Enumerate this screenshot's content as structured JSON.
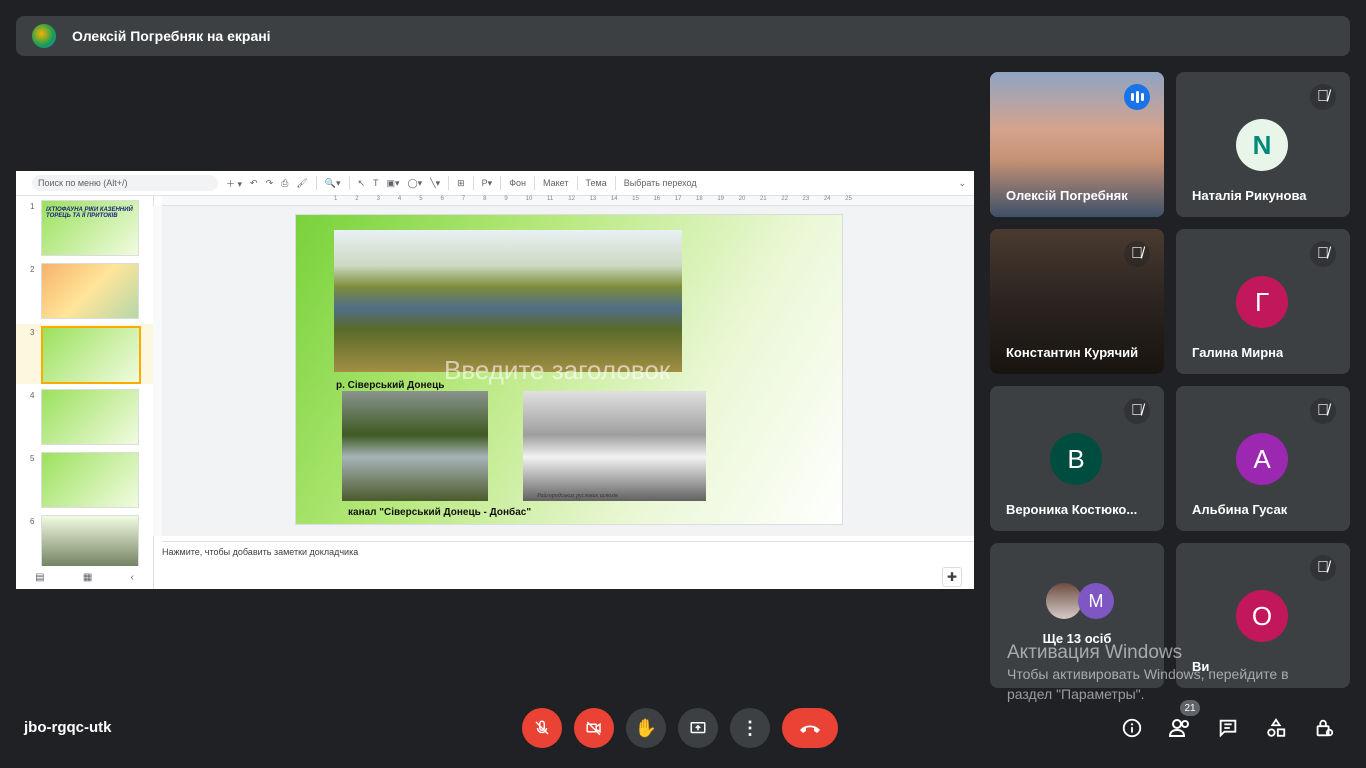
{
  "header": {
    "presenter_title": "Олексій Погребняк на екрані"
  },
  "toolbar": {
    "search_placeholder": "Поиск по меню (Alt+/)",
    "background": "Фон",
    "layout": "Макет",
    "theme": "Тема",
    "transition": "Выбрать переход"
  },
  "ruler": {
    "ticks": [
      "1",
      "2",
      "3",
      "4",
      "5",
      "6",
      "7",
      "8",
      "9",
      "10",
      "11",
      "12",
      "13",
      "14",
      "15",
      "16",
      "17",
      "18",
      "19",
      "20",
      "21",
      "22",
      "23",
      "24",
      "25"
    ]
  },
  "slides": [
    {
      "num": "1",
      "text": "ІХТІОФАУНА РІКИ КАЗЕННИЙ ТОРЕЦЬ ТА ЇЇ ПРИТОКІВ"
    },
    {
      "num": "2",
      "text": ""
    },
    {
      "num": "3",
      "text": ""
    },
    {
      "num": "4",
      "text": ""
    },
    {
      "num": "5",
      "text": ""
    },
    {
      "num": "6",
      "text": ""
    }
  ],
  "slide": {
    "ghost_title": "Введите заголовок",
    "caption1": "р. Сіверський Донець",
    "caption2": "канал \"Сіверський Донець - Донбас\"",
    "photo3_caption": "Райгородських руслових шлюзів"
  },
  "notes": {
    "placeholder": "Нажмите, чтобы добавить заметки докладчика"
  },
  "participants": [
    {
      "name": "Олексій Погребняк"
    },
    {
      "name": "Наталія Рикунова",
      "letter": "N"
    },
    {
      "name": "Константин Курячий"
    },
    {
      "name": "Галина Мирна",
      "letter": "Г",
      "color": "#c2185b"
    },
    {
      "name": "Вероника Костюко...",
      "letter": "В",
      "color": "#004d40"
    },
    {
      "name": "Альбина Гусак",
      "letter": "А",
      "color": "#9c27b0"
    },
    {
      "name": "Ще 13 осіб",
      "letter": "М",
      "color": "#7e57c2"
    },
    {
      "name": "Ви",
      "letter": "О",
      "color": "#c2185b"
    }
  ],
  "watermark": {
    "line1": "Активация Windows",
    "line2": "Чтобы активировать Windows, перейдите в раздел \"Параметры\"."
  },
  "footer": {
    "meeting_code": "jbo-rgqc-utk",
    "participant_count": "21"
  }
}
